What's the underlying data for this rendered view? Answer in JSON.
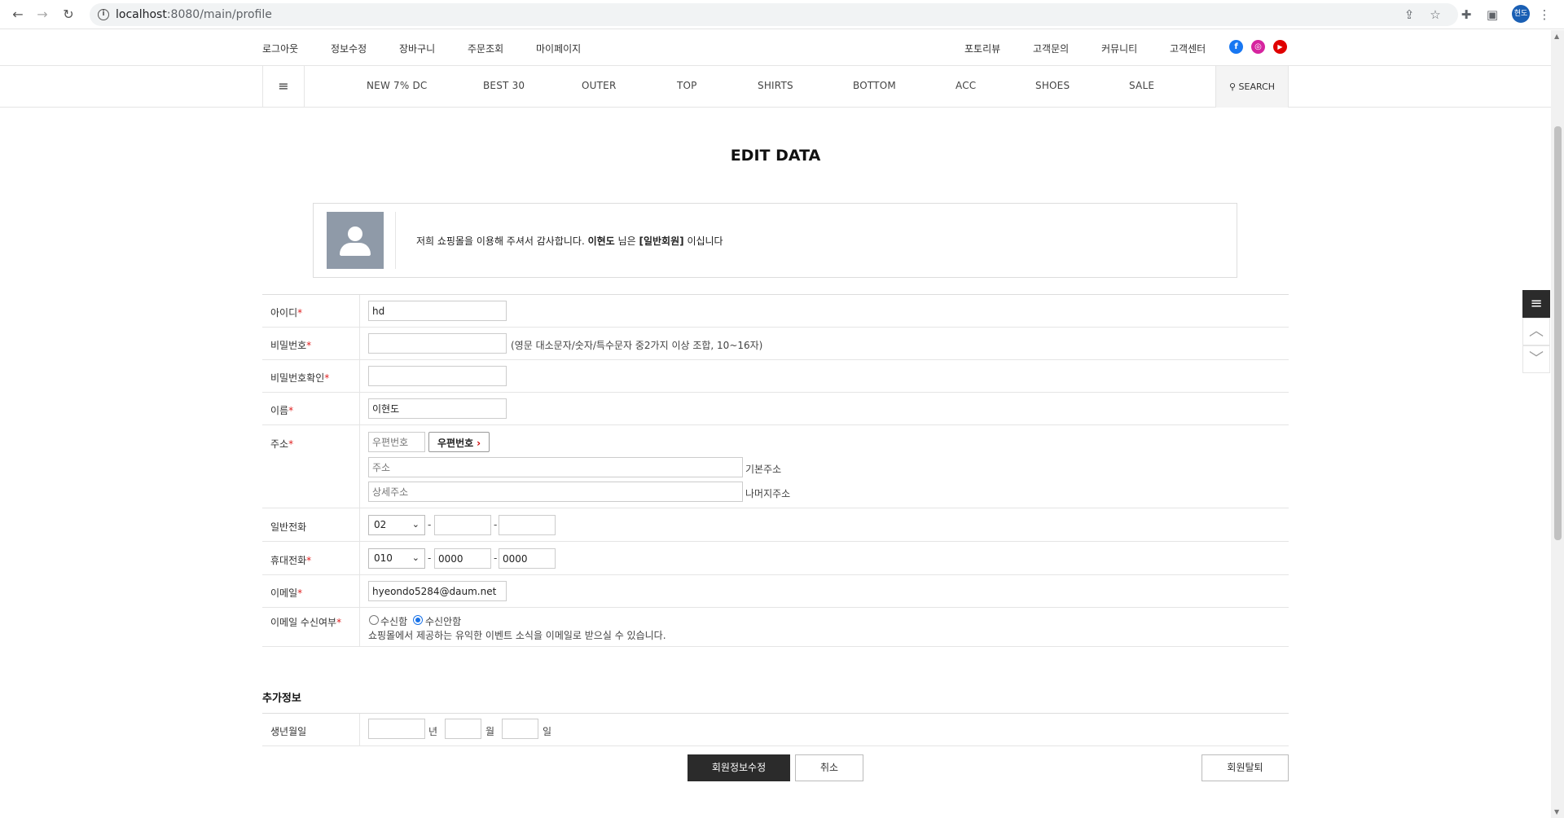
{
  "browser": {
    "url_host": "localhost",
    "url_path": ":8080/main/profile",
    "profile_initials": "현도"
  },
  "topbar": {
    "left_links": [
      "로그아웃",
      "정보수정",
      "장바구니",
      "주문조회",
      "마이페이지"
    ],
    "right_links": [
      "포토리뷰",
      "고객문의",
      "커뮤니티",
      "고객센터"
    ],
    "social": [
      {
        "name": "facebook",
        "glyph": "f",
        "color": "#1877f2"
      },
      {
        "name": "instagram",
        "glyph": "◎",
        "color": "#d6249f"
      },
      {
        "name": "youtube",
        "glyph": "▶",
        "color": "#e00000"
      }
    ]
  },
  "categories": [
    "NEW 7% DC",
    "BEST 30",
    "OUTER",
    "TOP",
    "SHIRTS",
    "BOTTOM",
    "ACC",
    "SHOES",
    "SALE"
  ],
  "search_label": "SEARCH",
  "page_title": "EDIT DATA",
  "welcome": {
    "prefix": "저희 쇼핑몰을 이용해 주셔서 감사합니다.",
    "user_name": "이현도",
    "middle": "님은",
    "grade": "[일반회원]",
    "suffix": "이십니다"
  },
  "form": {
    "id_label": "아이디",
    "id_value": "hd",
    "password_label": "비밀번호",
    "password_hint": "(영문 대소문자/숫자/특수문자 중2가지 이상 조합, 10~16자)",
    "password_confirm_label": "비밀번호확인",
    "name_label": "이름",
    "name_value": "이현도",
    "address_label": "주소",
    "zip_placeholder": "우편번호",
    "zip_button": "우편번호",
    "address_placeholder": "주소",
    "address_hint": "기본주소",
    "detail_placeholder": "상세주소",
    "detail_hint": "나머지주소",
    "phone_label": "일반전화",
    "phone_area": "02",
    "mobile_label": "휴대전화",
    "mobile_prefix": "010",
    "mobile_mid": "0000",
    "mobile_last": "0000",
    "email_label": "이메일",
    "email_value": "hyeondo5284@daum.net",
    "email_opt_label": "이메일 수신여부",
    "opt_in": "수신함",
    "opt_out": "수신안함",
    "opt_selected": "수신안함",
    "opt_note": "쇼핑몰에서 제공하는 유익한 이벤트 소식을 이메일로 받으실 수 있습니다.",
    "required_mark": "*",
    "dash": "-"
  },
  "extra": {
    "title": "추가정보",
    "birth_label": "생년월일",
    "year": "년",
    "month": "월",
    "day": "일"
  },
  "buttons": {
    "submit": "회원정보수정",
    "cancel": "취소",
    "withdraw": "회원탈퇴"
  }
}
